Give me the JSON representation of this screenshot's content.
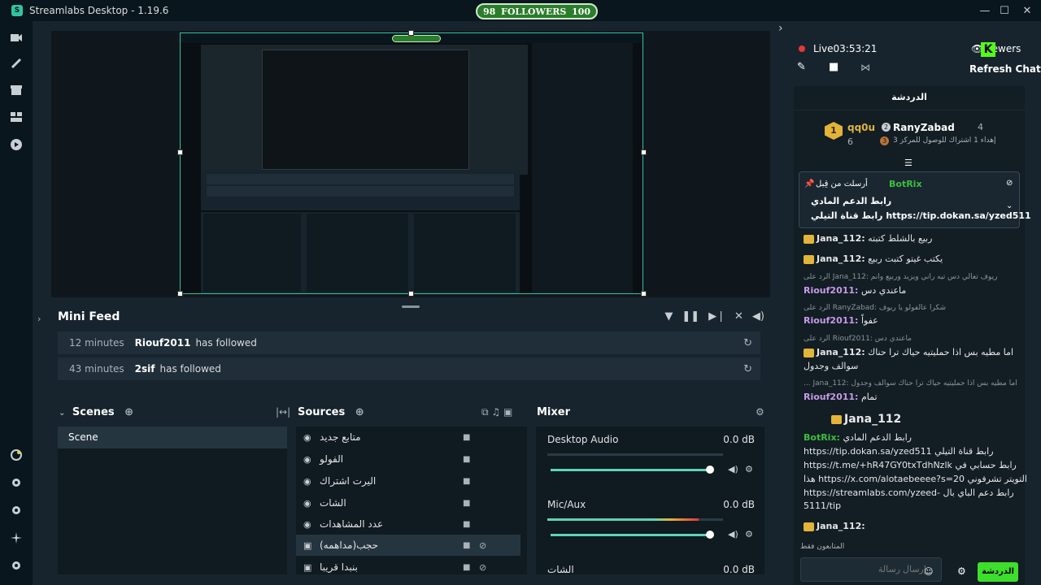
{
  "app": {
    "title": "Streamlabs Desktop - 1.19.6"
  },
  "followers_widget": {
    "current": "98",
    "label": "FOLLOWERS",
    "goal": "100"
  },
  "window_controls": {
    "minimize": "—",
    "maximize": "☐",
    "close": "✕"
  },
  "nav_icons": [
    "studio-icon",
    "themes-icon",
    "store-icon",
    "layout-icon",
    "play-icon",
    "dashboard-icon",
    "settings-gear-icon",
    "settings-gear-2-icon",
    "effects-icon",
    "gear-icon"
  ],
  "mini_feed": {
    "title": "Mini Feed",
    "rows": [
      {
        "time": "12 minutes",
        "name": "Riouf2011",
        "action": "has followed"
      },
      {
        "time": "43 minutes",
        "name": "2sif",
        "action": "has followed"
      }
    ]
  },
  "scenes": {
    "title": "Scenes",
    "items": [
      "Scene"
    ]
  },
  "sources": {
    "title": "Sources",
    "items": [
      {
        "label": "متابع جديد",
        "type": "globe"
      },
      {
        "label": "الفولو",
        "type": "globe"
      },
      {
        "label": "اليرت اشتراك",
        "type": "globe"
      },
      {
        "label": "الشات",
        "type": "globe"
      },
      {
        "label": "عدد المشاهدات",
        "type": "globe"
      },
      {
        "label": "حجب(مداهمه)",
        "type": "image",
        "selected": true
      },
      {
        "label": "بنبدا قريبا",
        "type": "image"
      }
    ]
  },
  "mixer": {
    "title": "Mixer",
    "channels": [
      {
        "name": "Desktop Audio",
        "db": "0.0 dB"
      },
      {
        "name": "Mic/Aux",
        "db": "0.0 dB"
      },
      {
        "name": "الشات",
        "db": "0.0 dB"
      }
    ]
  },
  "live": {
    "label": "Live",
    "timer": "03:53:21",
    "viewers": "viewers",
    "refresh_chat": "Refresh Chat"
  },
  "chat": {
    "header": "الدردشة",
    "leaders": {
      "first": "qq0u",
      "first_count": "6",
      "second": "RanyZabad",
      "second_count": "4",
      "note": "إهداء 1 اشتراك للوصول للمركز 3",
      "note_rank": "3"
    },
    "pinned": {
      "by": "BotRix",
      "sent_by_label": "أرسلت من قِبل",
      "line1": "رابط الدعم المادي",
      "line2": "رابط قناة التيلي https://tip.dokan.sa/yzed511"
    },
    "messages": [
      {
        "user": "Jana_112:",
        "text": "ربيع بالشلط كتبته"
      },
      {
        "user": "Jana_112:",
        "text": "يكتب غيتو كتبت ربيع"
      },
      {
        "reply": "الرد على Jana_112: ريوف تعالي دس تيه راني ويزيد وربيع وانم"
      },
      {
        "user": "Riouf2011:",
        "text": "ماعندي دس"
      },
      {
        "reply": "الرد على RanyZabad: شكرا عالفولو يا ريوف"
      },
      {
        "user": "Riouf2011:",
        "text": "عفواً"
      },
      {
        "reply": "الرد على Riouf2011: ماعندي دس"
      },
      {
        "user": "Jana_112:",
        "text": "اما مطيه بس اذا حمليتيه حياك ترا حناك"
      },
      {
        "text": "سوالف وجدول"
      },
      {
        "reply": "... Jana_112: اما مطيه بس اذا حمليتيه حياك ترا حناك سوالف وجدول"
      },
      {
        "user": "Riouf2011:",
        "text": "تمام"
      },
      {
        "user": "Jana_112",
        "text": ""
      },
      {
        "user": "BotRix:",
        "text": "رابط الدعم المادي"
      },
      {
        "text": "https://tip.dokan.sa/yzed511 رابط قناة التيلي"
      },
      {
        "text": "https://t.me/+hR47GY0txTdhNzlk رابط حسابي في"
      },
      {
        "text": "هذا https://x.com/alotaebeeee?s=20 التويتر تشرفوني"
      },
      {
        "text": "https://streamlabs.com/yzeed- رابط دعم الباي بال"
      },
      {
        "text": "5111/tip"
      },
      {
        "user": "Jana_112:",
        "text": ""
      }
    ],
    "subscribers_only": "المتابعون فقط",
    "input_placeholder": "إرسال رسالة",
    "send_label": "الدردشة"
  },
  "colors": {
    "accent": "#31c3a2",
    "live_red": "#e53935",
    "send_green": "#3dde2c",
    "kick_green": "#53fc18"
  }
}
